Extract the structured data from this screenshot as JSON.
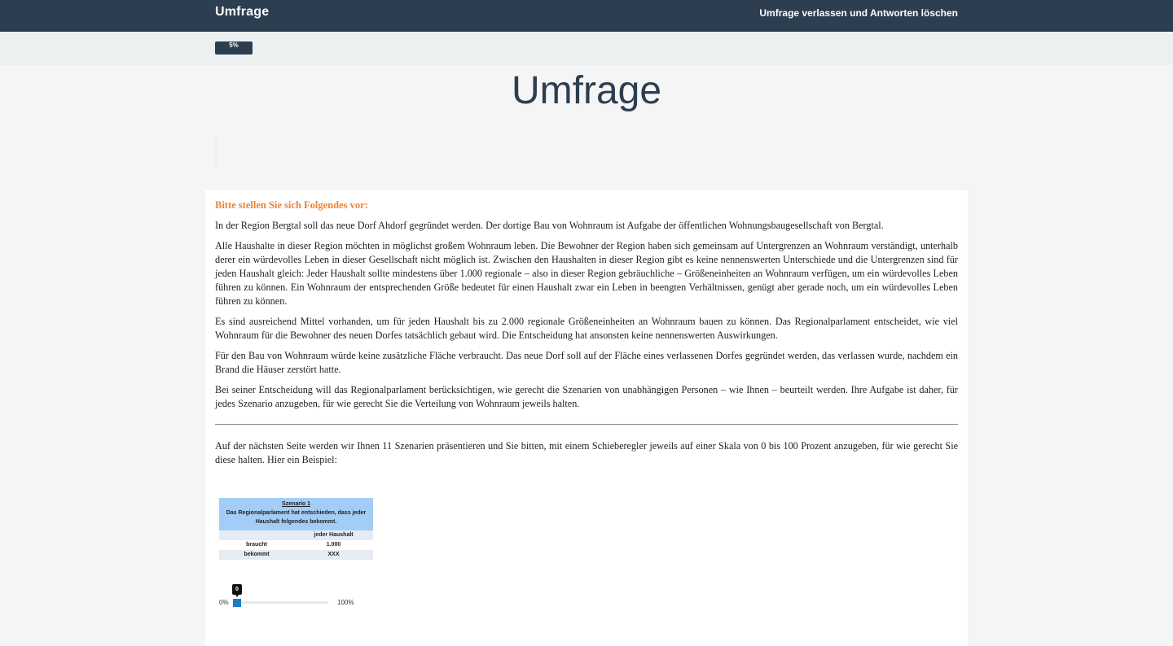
{
  "navbar": {
    "brand": "Umfrage",
    "exit_link": "Umfrage verlassen und Antworten löschen"
  },
  "progress": {
    "label": "5%",
    "value_percent": 5
  },
  "page_title": "Umfrage",
  "intro": {
    "heading": "Bitte stellen Sie sich Folgendes vor:",
    "paragraphs": [
      "In der Region Bergtal soll das neue Dorf Ahdorf gegründet werden. Der dortige Bau von Wohnraum ist Aufgabe der öffentlichen Wohnungsbaugesellschaft von Bergtal.",
      "Alle Haushalte in dieser Region möchten in möglichst großem Wohnraum leben. Die Bewohner der Region haben sich gemeinsam auf Untergrenzen an Wohnraum verständigt, unterhalb derer ein würdevolles Leben in dieser Gesellschaft nicht möglich ist. Zwischen den Haushalten in dieser Region gibt es keine nennenswerten Unterschiede und die Untergrenzen sind für jeden Haushalt gleich: Jeder Haushalt sollte mindestens über 1.000 regionale – also in dieser Region gebräuchliche – Größeneinheiten an Wohnraum verfügen, um ein würdevolles Leben führen zu können. Ein Wohnraum der entsprechenden Größe bedeutet für einen Haushalt zwar ein Leben in beengten Verhältnissen, genügt aber gerade noch, um ein würdevolles Leben führen zu können.",
      "Es sind ausreichend Mittel vorhanden, um für jeden Haushalt bis zu 2.000 regionale Größeneinheiten an Wohnraum bauen zu können. Das Regionalparlament entscheidet, wie viel Wohnraum für die Bewohner des neuen Dorfes tatsächlich gebaut wird. Die Entscheidung hat ansonsten keine nennenswerten Auswirkungen.",
      "Für den Bau von Wohnraum würde keine zusätzliche Fläche verbraucht. Das neue Dorf soll auf der Fläche eines verlassenen Dorfes gegründet werden, das verlassen wurde, nachdem ein Brand die Häuser zerstört hatte.",
      "Bei seiner Entscheidung will das Regionalparlament berücksichtigen, wie gerecht die Szenarien von unabhängigen Personen – wie Ihnen – beurteilt werden. Ihre Aufgabe ist daher, für jedes Szenario anzugeben, für wie gerecht Sie die Verteilung von Wohnraum jeweils halten."
    ],
    "next_page_text": "Auf der nächsten Seite werden wir Ihnen 11 Szenarien präsentieren und Sie bitten, mit einem Schieberegler jeweils auf einer Skala von 0 bis 100 Prozent anzugeben, für wie gerecht Sie diese halten. Hier ein Beispiel:"
  },
  "example": {
    "scenario_title": "Szenario 1",
    "scenario_text": "Das Regionalparlament hat entschieden, dass jeder Haushalt folgendes bekommt.",
    "column_header": "jeder Haushalt",
    "rows": [
      {
        "label": "braucht",
        "value": "1.000"
      },
      {
        "label": "bekommt",
        "value": "XXX"
      }
    ]
  },
  "slider": {
    "min_label": "0%",
    "max_label": "100%",
    "value": 0,
    "value_label": "0",
    "handle_color": "#1b7fc4"
  },
  "colors": {
    "navbar": "#2c3e50",
    "heading_accent": "#f0812f",
    "table_header": "#a3cdf7"
  }
}
